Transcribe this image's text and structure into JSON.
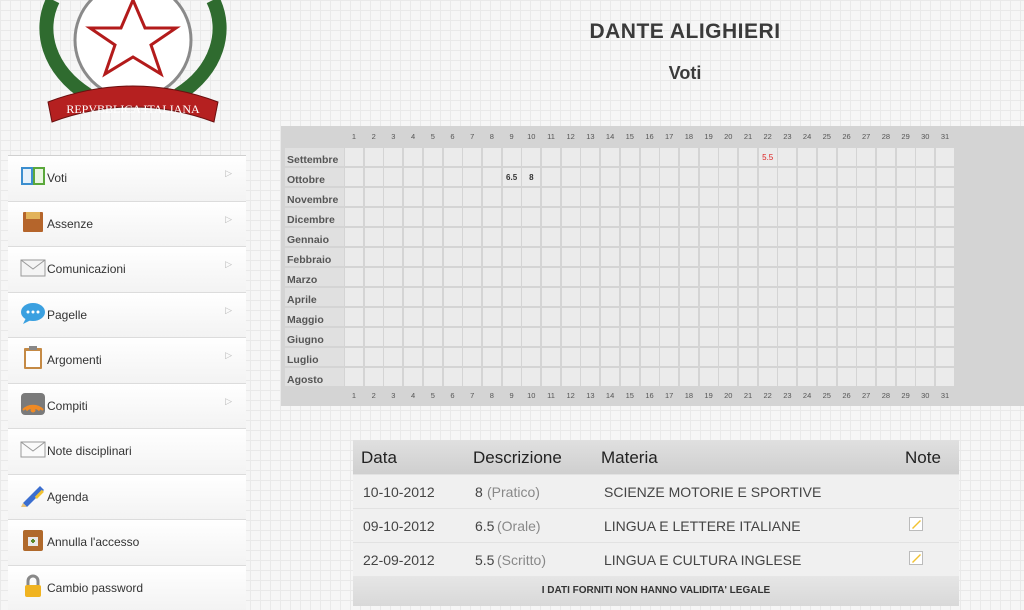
{
  "header": {
    "school_name": "DANTE ALIGHIERI",
    "page_title": "Voti",
    "emblem_text": "REPVBBLICA ITALIANA"
  },
  "sidebar": {
    "items": [
      {
        "label": "Voti",
        "icon": "book-icon",
        "has_arrow": true
      },
      {
        "label": "Assenze",
        "icon": "folder-icon",
        "has_arrow": true
      },
      {
        "label": "Comunicazioni",
        "icon": "mail-icon",
        "has_arrow": true
      },
      {
        "label": "Pagelle",
        "icon": "chat-bubble-icon",
        "has_arrow": true
      },
      {
        "label": "Argomenti",
        "icon": "clipboard-icon",
        "has_arrow": true
      },
      {
        "label": "Compiti",
        "icon": "rss-icon",
        "has_arrow": true
      },
      {
        "label": "Note disciplinari",
        "icon": "envelope-icon",
        "has_arrow": false
      },
      {
        "label": "Agenda",
        "icon": "pen-icon",
        "has_arrow": false
      },
      {
        "label": "Annulla l'accesso",
        "icon": "logout-icon",
        "has_arrow": false
      },
      {
        "label": "Cambio password",
        "icon": "padlock-icon",
        "has_arrow": false
      }
    ]
  },
  "grade_grid": {
    "days": [
      "1",
      "2",
      "3",
      "4",
      "5",
      "6",
      "7",
      "8",
      "9",
      "10",
      "11",
      "12",
      "13",
      "14",
      "15",
      "16",
      "17",
      "18",
      "19",
      "20",
      "21",
      "22",
      "23",
      "24",
      "25",
      "26",
      "27",
      "28",
      "29",
      "30",
      "31"
    ],
    "months": [
      "Settembre",
      "Ottobre",
      "Novembre",
      "Dicembre",
      "Gennaio",
      "Febbraio",
      "Marzo",
      "Aprile",
      "Maggio",
      "Giugno",
      "Luglio",
      "Agosto"
    ],
    "grades": [
      {
        "month": "Settembre",
        "day": 22,
        "value": "5.5",
        "insufficient": true
      },
      {
        "month": "Ottobre",
        "day": 9,
        "value": "6.5",
        "insufficient": false
      },
      {
        "month": "Ottobre",
        "day": 10,
        "value": "8",
        "insufficient": false
      }
    ],
    "insufficient_color": "#dd2222"
  },
  "table": {
    "headers": {
      "date": "Data",
      "description": "Descrizione",
      "subject": "Materia",
      "note": "Note"
    },
    "rows": [
      {
        "date": "10-10-2012",
        "grade": "8",
        "type": "(Pratico)",
        "subject": "SCIENZE MOTORIE E SPORTIVE",
        "has_note": false
      },
      {
        "date": "09-10-2012",
        "grade": "6.5",
        "type": "(Orale)",
        "subject": "LINGUA E LETTERE ITALIANE",
        "has_note": true
      },
      {
        "date": "22-09-2012",
        "grade": "5.5",
        "type": "(Scritto)",
        "subject": "LINGUA E CULTURA INGLESE",
        "has_note": true
      }
    ],
    "footer": "I DATI FORNITI NON HANNO VALIDITA' LEGALE"
  }
}
